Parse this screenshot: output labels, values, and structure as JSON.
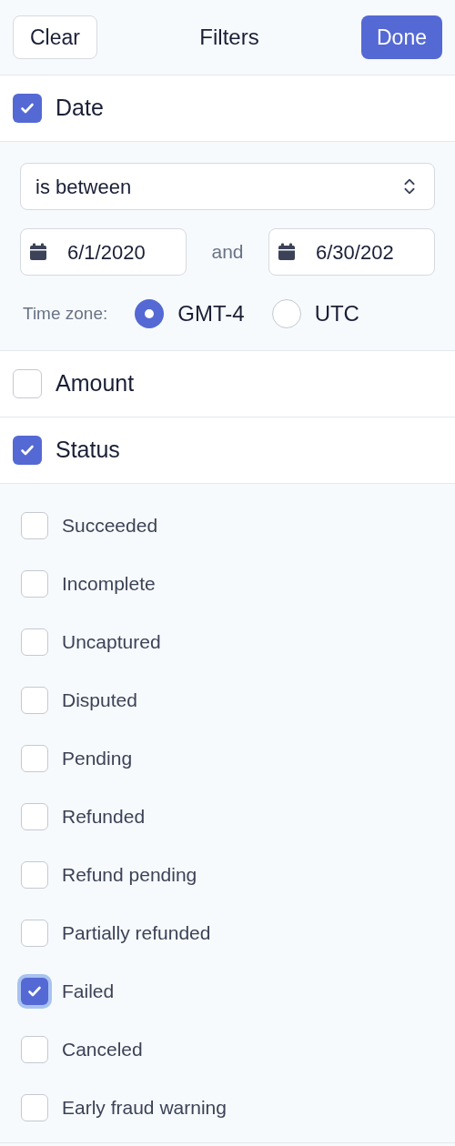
{
  "header": {
    "clear_button": "Clear",
    "title": "Filters",
    "done_button": "Done"
  },
  "sections": [
    {
      "kind": "date",
      "label": "Date",
      "checked": true,
      "operator": "is between",
      "start_date": "6/1/2020",
      "joiner": "and",
      "end_date": "6/30/202",
      "timezone_label": "Time zone:",
      "timezones": [
        {
          "label": "GMT-4",
          "selected": true
        },
        {
          "label": "UTC",
          "selected": false
        }
      ]
    },
    {
      "kind": "plain",
      "label": "Amount",
      "checked": false
    },
    {
      "kind": "options",
      "label": "Status",
      "checked": true,
      "options": [
        {
          "label": "Succeeded",
          "checked": false,
          "focused": false
        },
        {
          "label": "Incomplete",
          "checked": false,
          "focused": false
        },
        {
          "label": "Uncaptured",
          "checked": false,
          "focused": false
        },
        {
          "label": "Disputed",
          "checked": false,
          "focused": false
        },
        {
          "label": "Pending",
          "checked": false,
          "focused": false
        },
        {
          "label": "Refunded",
          "checked": false,
          "focused": false
        },
        {
          "label": "Refund pending",
          "checked": false,
          "focused": false
        },
        {
          "label": "Partially refunded",
          "checked": false,
          "focused": false
        },
        {
          "label": "Failed",
          "checked": true,
          "focused": true
        },
        {
          "label": "Canceled",
          "checked": false,
          "focused": false
        },
        {
          "label": "Early fraud warning",
          "checked": false,
          "focused": false
        }
      ]
    }
  ]
}
